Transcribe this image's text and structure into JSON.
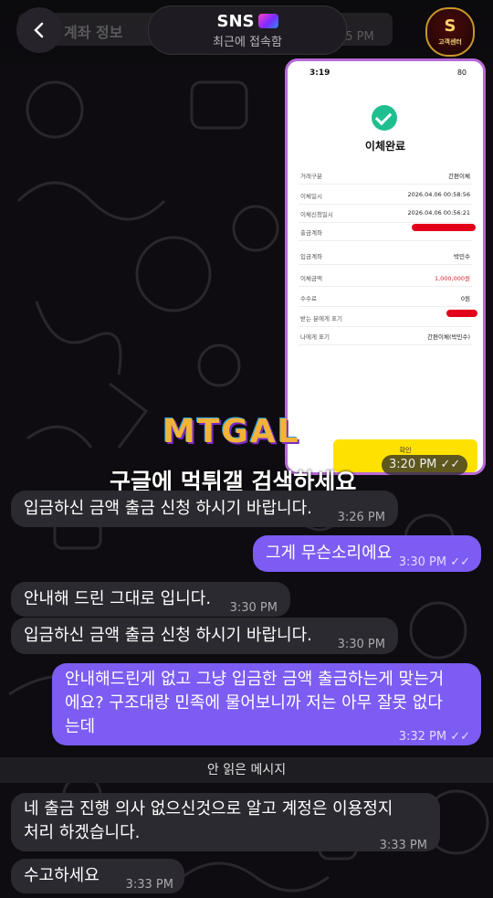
{
  "header": {
    "chat_title": "SNS",
    "chat_status": "최근에 접속함",
    "ghost_text": "계좌 정보",
    "ghost_time": "05 PM",
    "avatar_label": "고객센터",
    "avatar_letter": "S"
  },
  "shared_screenshot": {
    "status_time": "3:19",
    "status_right": "80",
    "heading": "이체완료",
    "rows": [
      {
        "key": "거래구분",
        "value": "간편이체"
      },
      {
        "key": "이체일시",
        "value": "2026.04.06 00:58:56"
      },
      {
        "key": "이체신청일시",
        "value": "2026.04.06 00:56:21"
      },
      {
        "key": "출금계좌",
        "value": ""
      },
      {
        "key": "입금계좌",
        "value": "박민수"
      },
      {
        "key": "이체금액",
        "value": "1,000,000원"
      },
      {
        "key": "수수료",
        "value": "0원"
      },
      {
        "key": "받는 분에게 표기",
        "value": ""
      },
      {
        "key": "나에게 표기",
        "value": "간편이체(박민수)"
      }
    ],
    "confirm_label": "확인",
    "time": "3:20 PM ✓✓",
    "amount_color": "#d1242a"
  },
  "watermark": {
    "logo": "MTGAL",
    "text": "구글에 먹튀갤 검색하세요"
  },
  "messages": [
    {
      "text": "입금하신 금액 출금 신청 하시기 바랍니다.",
      "time": "3:26 PM"
    },
    {
      "text": "그게 무슨소리에요",
      "time": "3:30 PM ✓✓"
    },
    {
      "text": "안내해 드린 그대로 입니다.",
      "time": "3:30 PM"
    },
    {
      "text": "입금하신 금액 출금 신청 하시기 바랍니다.",
      "time": "3:30 PM"
    },
    {
      "line1": "안내해드린게 없고 그냥 입금한 금액 출금하는게 맞는거",
      "line2": "에요? 구조대랑 민족에 물어보니까 저는 아무 잘못 없다",
      "line3": "는데",
      "time": "3:32 PM ✓✓"
    },
    {
      "line1": "네 출금 진행 의사 없으신것으로 알고 계정은 이용정지",
      "line2": "처리 하겠습니다.",
      "time": "3:33 PM"
    },
    {
      "text": "수고하세요",
      "time": "3:33 PM"
    }
  ],
  "unread_label": "안 읽은 메시지",
  "colors": {
    "incoming": "#2b2a30",
    "outgoing": "#7c5cf3",
    "accent": "#b66ad8"
  }
}
